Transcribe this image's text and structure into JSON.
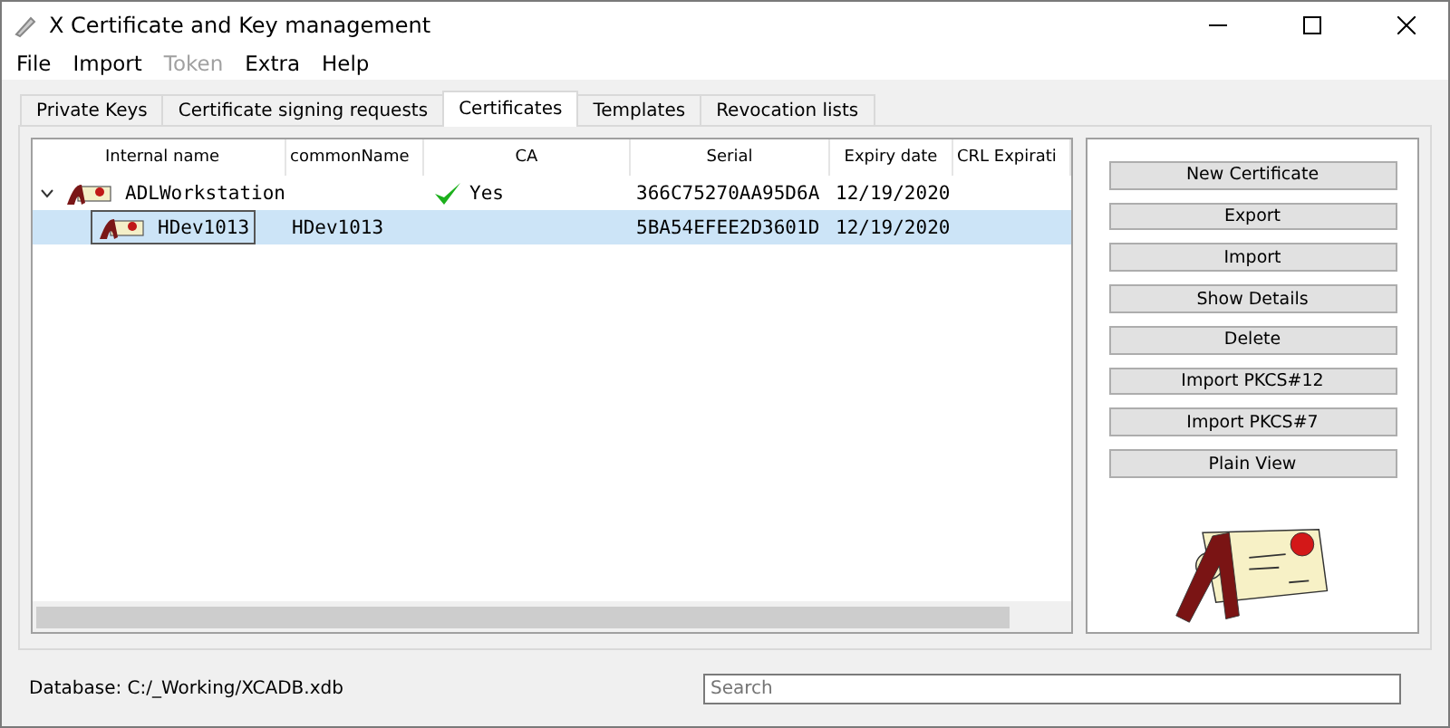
{
  "window": {
    "title": "X Certificate and Key management"
  },
  "menu": [
    {
      "label": "File",
      "disabled": false
    },
    {
      "label": "Import",
      "disabled": false
    },
    {
      "label": "Token",
      "disabled": true
    },
    {
      "label": "Extra",
      "disabled": false
    },
    {
      "label": "Help",
      "disabled": false
    }
  ],
  "tabs": [
    {
      "label": "Private Keys",
      "selected": false
    },
    {
      "label": "Certificate signing requests",
      "selected": false
    },
    {
      "label": "Certificates",
      "selected": true
    },
    {
      "label": "Templates",
      "selected": false
    },
    {
      "label": "Revocation lists",
      "selected": false
    }
  ],
  "table": {
    "columns": [
      "Internal name",
      "commonName",
      "CA",
      "Serial",
      "Expiry date",
      "CRL Expirati"
    ],
    "rows": [
      {
        "internal_name": "ADLWorkstation",
        "ca": "Yes",
        "ca_checked": true,
        "serial": "366C75270AA95D6A",
        "expiry": "12/19/2020",
        "expanded": true,
        "selected": false,
        "children": [
          {
            "internal_name": "HDev1013",
            "common_name": "HDev1013",
            "ca_checked": false,
            "serial": "5BA54EFEE2D3601D",
            "expiry": "12/19/2020",
            "selected": true
          }
        ]
      }
    ]
  },
  "buttons": [
    "New Certificate",
    "Export",
    "Import",
    "Show Details",
    "Delete",
    "Import PKCS#12",
    "Import PKCS#7",
    "Plain View"
  ],
  "status_bar": {
    "database": "Database: C:/_Working/XCADB.xdb",
    "search": {
      "placeholder": "Search"
    }
  }
}
